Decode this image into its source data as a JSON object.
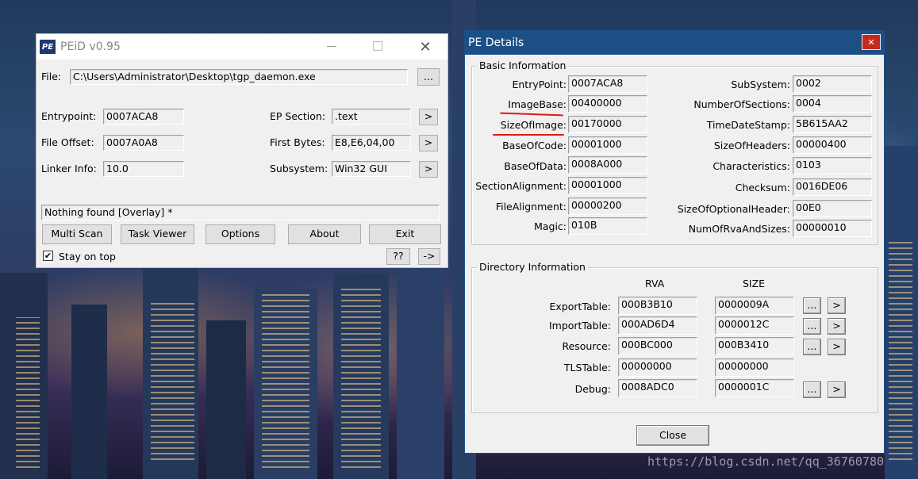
{
  "peid": {
    "title": "PEiD v0.95",
    "logo_text": "PE",
    "file_label": "File:",
    "file_path": "C:\\Users\\Administrator\\Desktop\\tgp_daemon.exe",
    "browse_label": "...",
    "entrypoint_label": "Entrypoint:",
    "entrypoint_value": "0007ACA8",
    "file_offset_label": "File Offset:",
    "file_offset_value": "0007A0A8",
    "linker_label": "Linker Info:",
    "linker_value": "10.0",
    "ep_section_label": "EP Section:",
    "ep_section_value": ".text",
    "first_bytes_label": "First Bytes:",
    "first_bytes_value": "E8,E6,04,00",
    "subsystem_label": "Subsystem:",
    "subsystem_value": "Win32 GUI",
    "arrow_label": ">",
    "result": "Nothing found [Overlay] *",
    "buttons": {
      "multi_scan": "Multi Scan",
      "task_viewer": "Task Viewer",
      "options": "Options",
      "about": "About",
      "exit": "Exit"
    },
    "stay_on_top_label": "Stay on top",
    "stay_on_top_checked": true,
    "help_label": "??",
    "ext_label": "->"
  },
  "pe_details": {
    "title": "PE Details",
    "close_x": "✕",
    "basic_group": "Basic Information",
    "basic_left": [
      {
        "label": "EntryPoint:",
        "value": "0007ACA8"
      },
      {
        "label": "ImageBase:",
        "value": "00400000"
      },
      {
        "label": "SizeOfImage:",
        "value": "00170000"
      },
      {
        "label": "BaseOfCode:",
        "value": "00001000"
      },
      {
        "label": "BaseOfData:",
        "value": "0008A000"
      },
      {
        "label": "SectionAlignment:",
        "value": "00001000"
      },
      {
        "label": "FileAlignment:",
        "value": "00000200"
      },
      {
        "label": "Magic:",
        "value": "010B"
      }
    ],
    "basic_right": [
      {
        "label": "SubSystem:",
        "value": "0002"
      },
      {
        "label": "NumberOfSections:",
        "value": "0004"
      },
      {
        "label": "TimeDateStamp:",
        "value": "5B615AA2"
      },
      {
        "label": "SizeOfHeaders:",
        "value": "00000400"
      },
      {
        "label": "Characteristics:",
        "value": "0103"
      },
      {
        "label": "Checksum:",
        "value": "0016DE06"
      },
      {
        "label": "SizeOfOptionalHeader:",
        "value": "00E0"
      },
      {
        "label": "NumOfRvaAndSizes:",
        "value": "00000010"
      }
    ],
    "dir_group": "Directory Information",
    "rva_header": "RVA",
    "size_header": "SIZE",
    "directories": [
      {
        "label": "ExportTable:",
        "rva": "000B3B10",
        "size": "0000009A"
      },
      {
        "label": "ImportTable:",
        "rva": "000AD6D4",
        "size": "0000012C"
      },
      {
        "label": "Resource:",
        "rva": "000BC000",
        "size": "000B3410"
      },
      {
        "label": "TLSTable:",
        "rva": "00000000",
        "size": "00000000"
      },
      {
        "label": "Debug:",
        "rva": "0008ADC0",
        "size": "0000001C"
      }
    ],
    "dots_label": "...",
    "arrow_label": ">",
    "close_button": "Close"
  },
  "watermark": "https://blog.csdn.net/qq_36760780",
  "colors": {
    "pe_details_titlebar": "#1c4f86",
    "close_x_bg": "#c42b1c",
    "annotation_red": "#e01818"
  }
}
